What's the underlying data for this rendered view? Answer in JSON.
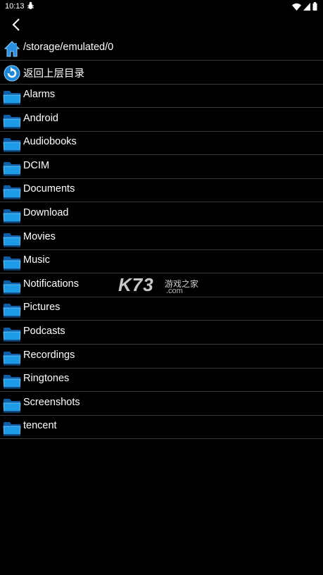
{
  "status_bar": {
    "time": "10:13",
    "debug_icon": "bug-icon",
    "wifi_icon": "wifi-icon",
    "signal_icon": "signal-icon",
    "battery_icon": "battery-icon"
  },
  "toolbar": {
    "back_icon": "chevron-left-icon"
  },
  "path": {
    "icon": "home-icon",
    "label": "/storage/emulated/0"
  },
  "up_dir": {
    "icon": "up-arrow-circle-icon",
    "label": "返回上层目录"
  },
  "folders": [
    {
      "label": "Alarms",
      "icon": "folder-icon"
    },
    {
      "label": "Android",
      "icon": "folder-icon"
    },
    {
      "label": "Audiobooks",
      "icon": "folder-icon"
    },
    {
      "label": "DCIM",
      "icon": "folder-icon"
    },
    {
      "label": "Documents",
      "icon": "folder-icon"
    },
    {
      "label": "Download",
      "icon": "folder-icon"
    },
    {
      "label": "Movies",
      "icon": "folder-icon"
    },
    {
      "label": "Music",
      "icon": "folder-icon"
    },
    {
      "label": "Notifications",
      "icon": "folder-icon"
    },
    {
      "label": "Pictures",
      "icon": "folder-icon"
    },
    {
      "label": "Podcasts",
      "icon": "folder-icon"
    },
    {
      "label": "Recordings",
      "icon": "folder-icon"
    },
    {
      "label": "Ringtones",
      "icon": "folder-icon"
    },
    {
      "label": "Screenshots",
      "icon": "folder-icon"
    },
    {
      "label": "tencent",
      "icon": "folder-icon"
    }
  ],
  "watermark": {
    "brand": "K73",
    "cn": "游戏之家",
    "domain": ".com"
  },
  "colors": {
    "background": "#000000",
    "folder_blue": "#1e9be6",
    "divider": "#3b3b3b"
  }
}
